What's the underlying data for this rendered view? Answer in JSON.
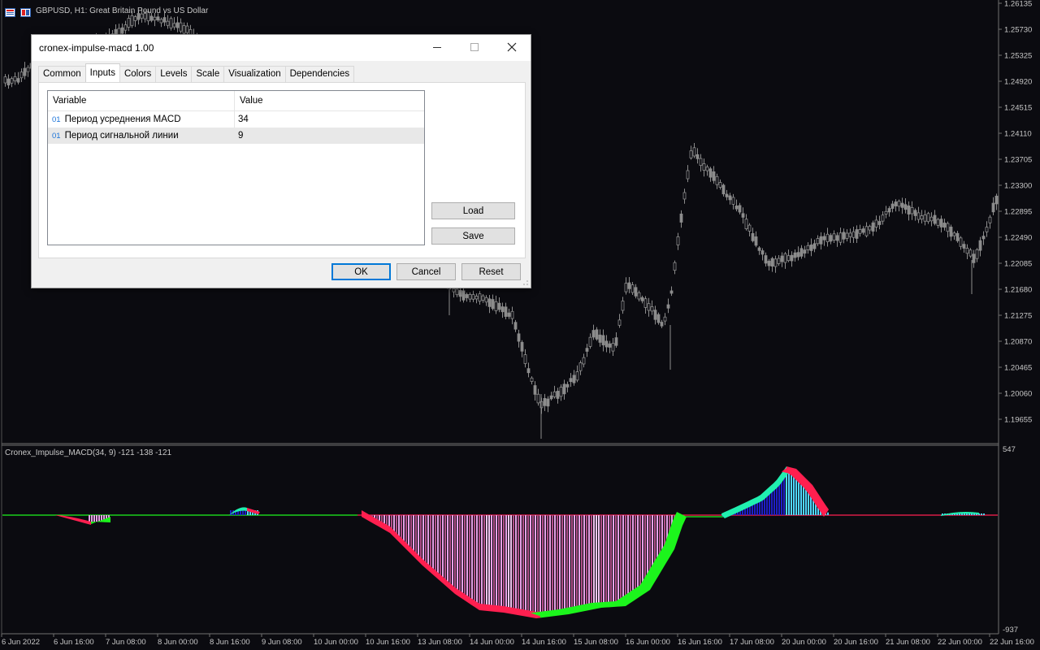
{
  "chart": {
    "header_title": "GBPUSD, H1:  Great Britain Pound vs US Dollar",
    "price_axis": [
      "1.26135",
      "1.25730",
      "1.25325",
      "1.24920",
      "1.24515",
      "1.24110",
      "1.23705",
      "1.23300",
      "1.22895",
      "1.22490",
      "1.22085",
      "1.21680",
      "1.21275",
      "1.20870",
      "1.20465",
      "1.20060",
      "1.19655"
    ],
    "time_axis": [
      "6 Jun 2022",
      "6 Jun 16:00",
      "7 Jun 08:00",
      "8 Jun 00:00",
      "8 Jun 16:00",
      "9 Jun 08:00",
      "10 Jun 00:00",
      "10 Jun 16:00",
      "13 Jun 08:00",
      "14 Jun 00:00",
      "14 Jun 16:00",
      "15 Jun 08:00",
      "16 Jun 00:00",
      "16 Jun 16:00",
      "17 Jun 08:00",
      "20 Jun 00:00",
      "20 Jun 16:00",
      "21 Jun 08:00",
      "22 Jun 00:00",
      "22 Jun 16:00"
    ],
    "candle_color": "#8c8c8c",
    "background_color": "#0b0b10"
  },
  "subwindow": {
    "title": "Cronex_Impulse_MACD(34, 9) -121 -138 -121",
    "axis_top": "547",
    "axis_bottom": "-937",
    "colors": {
      "red": "#ff1f4f",
      "green": "#1cf51c",
      "pink_hist": "#e8a0e8",
      "blue_hist": "#1e1ec8",
      "cyan_hist": "#4fd8ff",
      "aqua": "#20f0b0"
    }
  },
  "dialog": {
    "title": "cronex-impulse-macd 1.00",
    "minimize_icon": "minimize-icon",
    "maximize_icon": "maximize-icon",
    "close_icon": "close-icon",
    "tabs": [
      "Common",
      "Inputs",
      "Colors",
      "Levels",
      "Scale",
      "Visualization",
      "Dependencies"
    ],
    "active_tab": "Inputs",
    "table": {
      "headers": {
        "variable": "Variable",
        "value": "Value"
      },
      "rows": [
        {
          "badge": "01",
          "name": "Период усреднения MACD",
          "value": "34"
        },
        {
          "badge": "01",
          "name": "Период сигнальной линии",
          "value": "9"
        }
      ]
    },
    "buttons": {
      "load": "Load",
      "save": "Save",
      "ok": "OK",
      "cancel": "Cancel",
      "reset": "Reset"
    }
  }
}
